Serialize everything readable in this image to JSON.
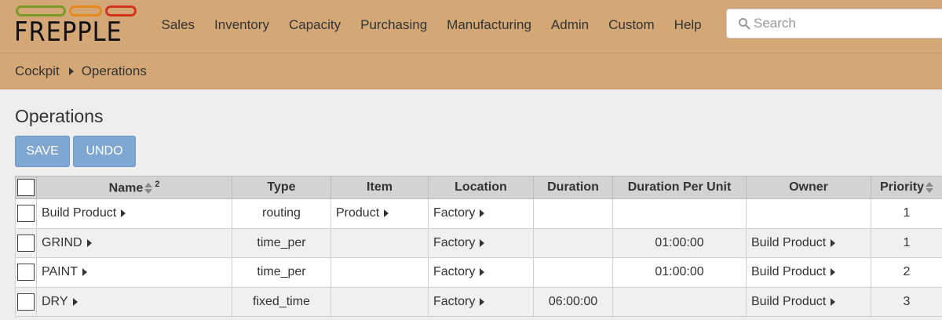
{
  "app": {
    "logo_text": "FREPPLE",
    "colors": {
      "header_bg": "#d4a876",
      "button_bg": "#7fa7d1",
      "ring_green": "#7a9a2a",
      "ring_orange": "#e58a1f",
      "ring_red": "#d2321e"
    }
  },
  "menu": {
    "items": [
      "Sales",
      "Inventory",
      "Capacity",
      "Purchasing",
      "Manufacturing",
      "Admin",
      "Custom",
      "Help"
    ]
  },
  "search": {
    "placeholder": "Search",
    "icon": "search-icon"
  },
  "breadcrumb": {
    "items": [
      "Cockpit",
      "Operations"
    ]
  },
  "page": {
    "title": "Operations"
  },
  "toolbar": {
    "save_label": "SAVE",
    "undo_label": "UNDO"
  },
  "table": {
    "columns": [
      "Name",
      "Type",
      "Item",
      "Location",
      "Duration",
      "Duration Per Unit",
      "Owner",
      "Priority"
    ],
    "sort_index": "2",
    "rows": [
      {
        "name": "Build Product",
        "type": "routing",
        "item": "Product",
        "location": "Factory",
        "duration": "",
        "duration_per_unit": "",
        "owner": "",
        "priority": "1"
      },
      {
        "name": "GRIND",
        "type": "time_per",
        "item": "",
        "location": "Factory",
        "duration": "",
        "duration_per_unit": "01:00:00",
        "owner": "Build Product",
        "priority": "1"
      },
      {
        "name": "PAINT",
        "type": "time_per",
        "item": "",
        "location": "Factory",
        "duration": "",
        "duration_per_unit": "01:00:00",
        "owner": "Build Product",
        "priority": "2"
      },
      {
        "name": "DRY",
        "type": "fixed_time",
        "item": "",
        "location": "Factory",
        "duration": "06:00:00",
        "duration_per_unit": "",
        "owner": "Build Product",
        "priority": "3"
      }
    ]
  }
}
